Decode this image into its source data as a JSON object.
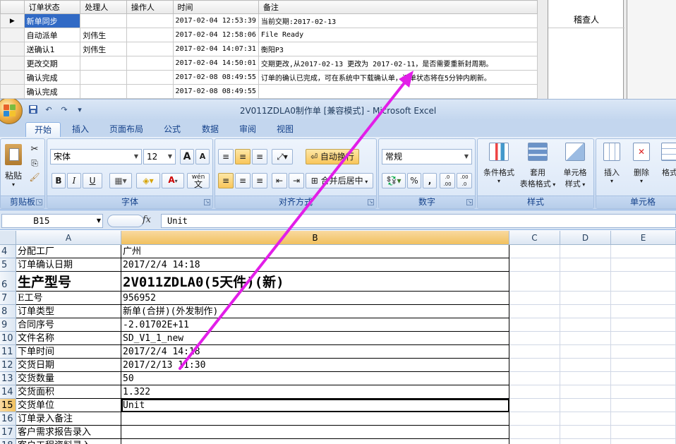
{
  "order_table": {
    "headers": [
      "订单状态",
      "处理人",
      "操作人",
      "时间",
      "备注"
    ],
    "rows": [
      {
        "marker": "▶",
        "status": "新单同步",
        "handler": "",
        "operator": "",
        "time": "2017-02-04 12:53:39",
        "note": "当前交期:2017-02-13"
      },
      {
        "marker": "",
        "status": "自动派单",
        "handler": "刘伟生",
        "operator": "",
        "time": "2017-02-04 12:58:06",
        "note": "File Ready"
      },
      {
        "marker": "",
        "status": "送确认1",
        "handler": "刘伟生",
        "operator": "",
        "time": "2017-02-04 14:07:31",
        "note": "衡阳P3"
      },
      {
        "marker": "",
        "status": "更改交期",
        "handler": "",
        "operator": "",
        "time": "2017-02-04 14:50:01",
        "note": "交期更改,从2017-02-13 更改为 2017-02-11，是否需要重新封周期。"
      },
      {
        "marker": "",
        "status": "确认完成",
        "handler": "",
        "operator": "",
        "time": "2017-02-08 08:49:55",
        "note": "订单的确认已完成，可在系统中下载确认单，订单状态将在5分钟内刷新。"
      },
      {
        "marker": "",
        "status": "确认完成",
        "handler": "",
        "operator": "",
        "time": "2017-02-08 08:49:55",
        "note": ""
      }
    ]
  },
  "side_panel": {
    "header": "稽查人"
  },
  "excel": {
    "title": "2V011ZDLA0制作单  [兼容模式] - Microsoft Excel",
    "tabs": [
      "开始",
      "插入",
      "页面布局",
      "公式",
      "数据",
      "审阅",
      "视图"
    ],
    "ribbon": {
      "clipboard": {
        "label": "剪贴板",
        "paste": "粘贴"
      },
      "font": {
        "label": "字体",
        "name": "宋体",
        "size": "12",
        "grow": "A",
        "shrink": "A",
        "bold": "B",
        "italic": "I",
        "underline": "U",
        "color_a": "A",
        "wen": "wén",
        "wen2": "文"
      },
      "alignment": {
        "label": "对齐方式",
        "wrap": "自动换行",
        "merge": "合并后居中"
      },
      "number": {
        "label": "数字",
        "format": "常规",
        "percent": "%",
        "comma": ",",
        "inc": ".0 .00",
        "dec": ".00 .0"
      },
      "styles": {
        "label": "样式",
        "conditional": "条件格式",
        "table1": "套用",
        "table2": "表格格式",
        "cell1": "单元格",
        "cell2": "样式"
      },
      "cells": {
        "label": "单元格",
        "insert": "插入",
        "delete": "删除",
        "format": "格式"
      }
    },
    "name_box": "B15",
    "fx": "fx",
    "formula": "Unit",
    "columns": [
      "A",
      "B",
      "C",
      "D",
      "E"
    ],
    "rows": [
      {
        "n": "4",
        "a": "分配工厂",
        "b": "广州"
      },
      {
        "n": "5",
        "a": "订单确认日期",
        "b": "2017/2/4 14:18"
      },
      {
        "n": "6",
        "a": "生产型号",
        "b": "2V011ZDLA0(5天件)(新)"
      },
      {
        "n": "7",
        "a": "E工号",
        "b": "956952"
      },
      {
        "n": "8",
        "a": "订单类型",
        "b": "新单(合拼)(外发制作)"
      },
      {
        "n": "9",
        "a": "合同序号",
        "b": "-2.01702E+11"
      },
      {
        "n": "10",
        "a": "文件名称",
        "b": "SD_V1_1_new"
      },
      {
        "n": "11",
        "a": "下单时间",
        "b": "2017/2/4 14:18"
      },
      {
        "n": "12",
        "a": "交货日期",
        "b": "2017/2/13 11:30"
      },
      {
        "n": "13",
        "a": "交货数量",
        "b": "50"
      },
      {
        "n": "14",
        "a": "交货面积",
        "b": "1.322"
      },
      {
        "n": "15",
        "a": "交货单位",
        "b": "Unit"
      },
      {
        "n": "16",
        "a": "订单录入备注",
        "b": ""
      },
      {
        "n": "17",
        "a": "客户需求报告录入",
        "b": ""
      },
      {
        "n": "18",
        "a": "客户工程资料录入",
        "b": ""
      }
    ]
  },
  "annotation": {
    "color": "#e21ee8"
  }
}
